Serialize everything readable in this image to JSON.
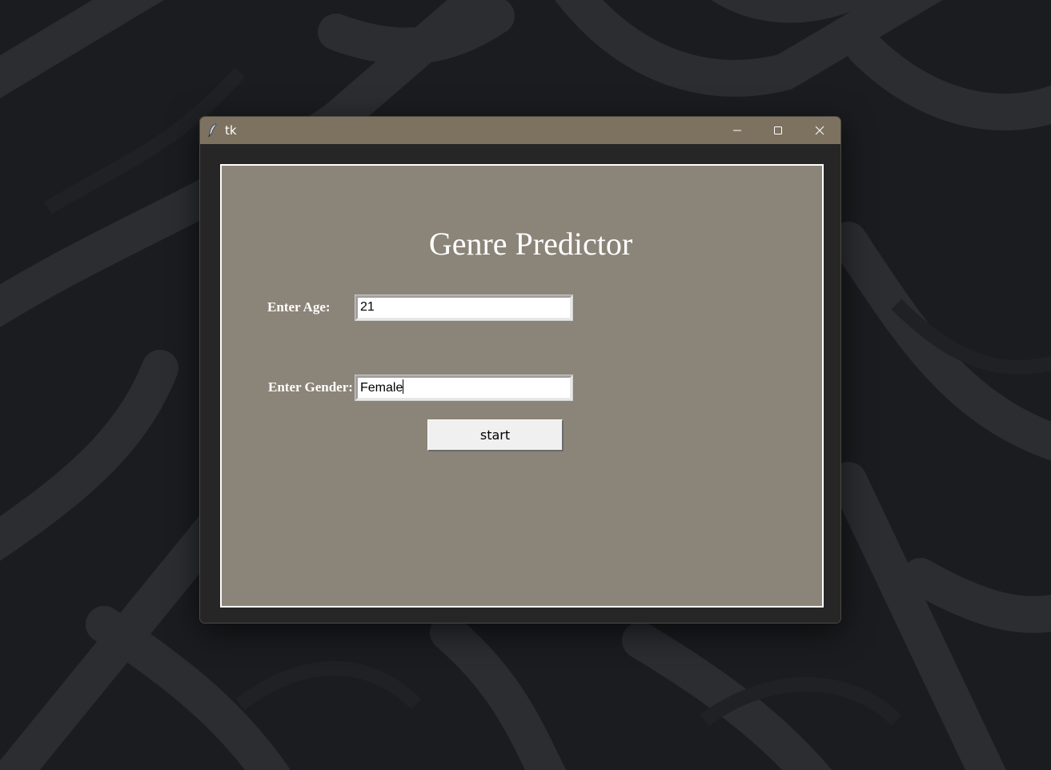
{
  "window": {
    "title": "tk",
    "titlebar_color": "#7c725f",
    "controls": {
      "minimize_icon": "minimize-icon",
      "maximize_icon": "maximize-icon",
      "close_icon": "close-icon"
    }
  },
  "form": {
    "background": "#8b8478",
    "heading": "Genre Predictor",
    "age_label": "Enter Age:",
    "age_value": "21",
    "gender_label": "Enter Gender:",
    "gender_value": "Female",
    "start_label": "start"
  }
}
